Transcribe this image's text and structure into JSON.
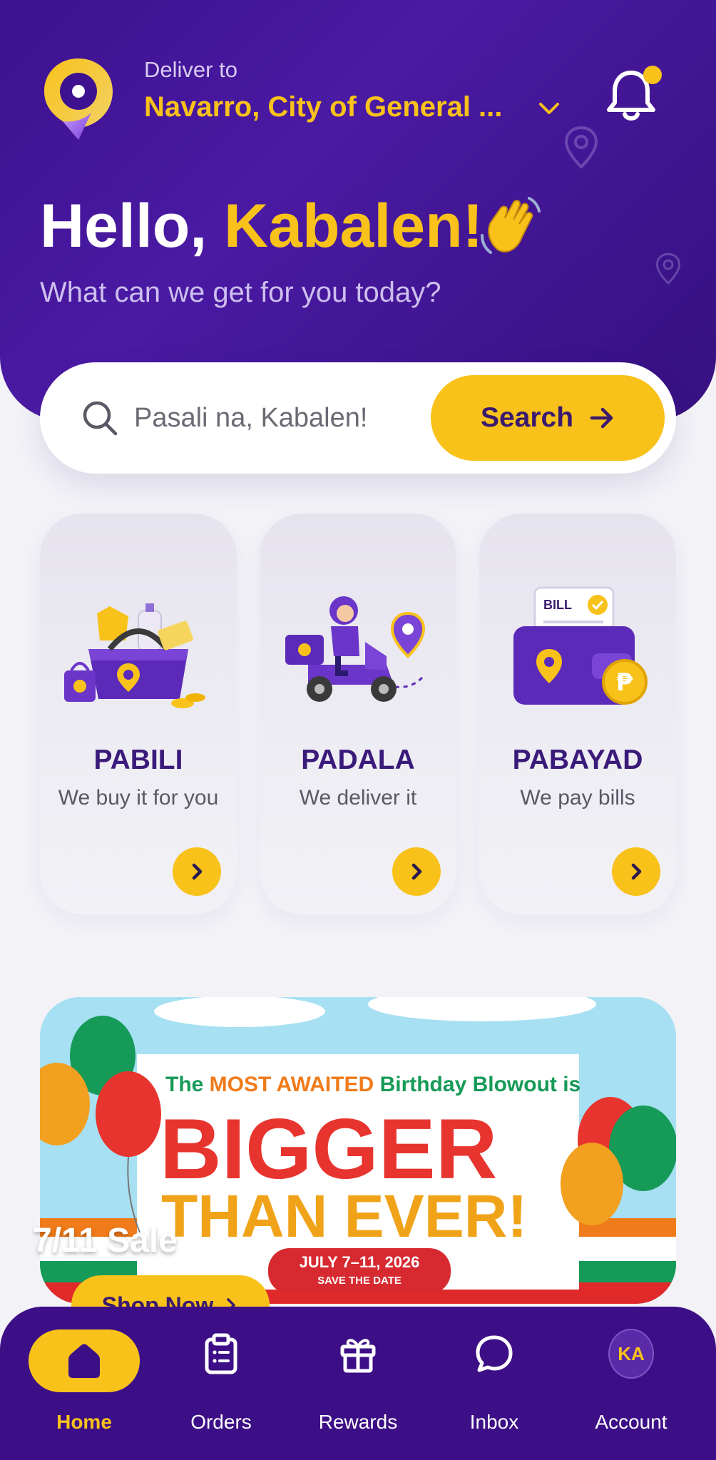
{
  "header": {
    "deliver_label": "Deliver to",
    "address": "Navarro, City of General ...",
    "greeting_prefix": "Hello, ",
    "greeting_name": "Kabalen!",
    "subtitle": "What can we get for you today?"
  },
  "search": {
    "placeholder": "Pasali na, Kabalen!",
    "button_label": "Search"
  },
  "services": [
    {
      "title": "PABILI",
      "desc": "We buy it for you"
    },
    {
      "title": "PADALA",
      "desc": "We deliver it"
    },
    {
      "title": "PABAYAD",
      "desc": "We pay bills"
    }
  ],
  "banner": {
    "headline_line1_a": "The ",
    "headline_line1_b": "MOST AWAITED",
    "headline_line1_c": " Birthday Blowout is",
    "big_text": "BIGGER",
    "big_text2": "THAN EVER!",
    "date_text": "JULY 7–11, 2026",
    "save_text": "SAVE THE DATE",
    "title": "7/11 Sale",
    "button_label": "Shop Now"
  },
  "nav": {
    "items": [
      {
        "label": "Home",
        "icon": "home-icon",
        "active": true
      },
      {
        "label": "Orders",
        "icon": "clipboard-icon"
      },
      {
        "label": "Rewards",
        "icon": "gift-icon"
      },
      {
        "label": "Inbox",
        "icon": "chat-icon"
      },
      {
        "label": "Account",
        "icon": "avatar"
      }
    ],
    "avatar_initials": "KA"
  },
  "colors": {
    "brand_purple": "#3d118f",
    "accent_yellow": "#f8c21b"
  }
}
